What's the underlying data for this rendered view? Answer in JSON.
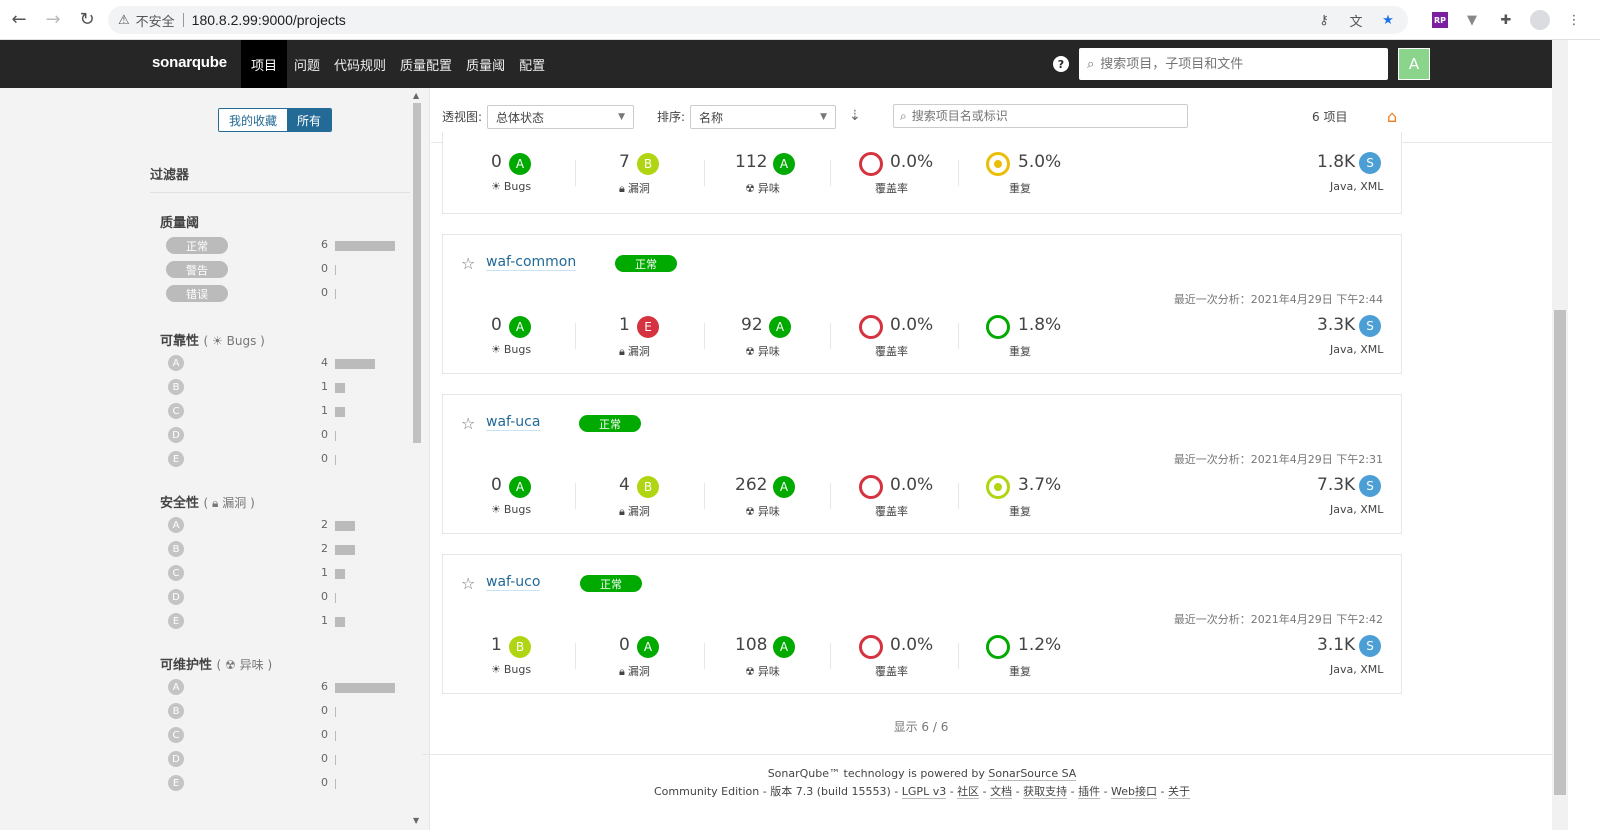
{
  "browser": {
    "back_icon": "arrow-left-icon",
    "forward_icon": "arrow-right-icon",
    "reload_icon": "reload-icon",
    "insecure_label": "不安全",
    "url": "180.8.2.99:9000/projects",
    "ext_rp": "RP"
  },
  "nav": {
    "logo_text": "sonarqube",
    "items": [
      "项目",
      "问题",
      "代码规则",
      "质量配置",
      "质量阈",
      "配置"
    ],
    "search_placeholder": "搜索项目，子项目和文件",
    "user_initial": "A"
  },
  "sidebar": {
    "fav_label": "我的收藏",
    "all_label": "所有",
    "filters_title": "过滤器",
    "quality_gate": {
      "title": "质量阈",
      "rows": [
        {
          "label": "正常",
          "count": "6"
        },
        {
          "label": "警告",
          "count": "0"
        },
        {
          "label": "错误",
          "count": "0"
        }
      ]
    },
    "reliability": {
      "title": "可靠性",
      "sub": "Bugs",
      "rows": [
        {
          "label": "A",
          "count": "4"
        },
        {
          "label": "B",
          "count": "1"
        },
        {
          "label": "C",
          "count": "1"
        },
        {
          "label": "D",
          "count": "0"
        },
        {
          "label": "E",
          "count": "0"
        }
      ]
    },
    "security": {
      "title": "安全性",
      "sub": "漏洞",
      "rows": [
        {
          "label": "A",
          "count": "2"
        },
        {
          "label": "B",
          "count": "2"
        },
        {
          "label": "C",
          "count": "1"
        },
        {
          "label": "D",
          "count": "0"
        },
        {
          "label": "E",
          "count": "1"
        }
      ]
    },
    "maintainability": {
      "title": "可维护性",
      "sub": "异味",
      "rows": [
        {
          "label": "A",
          "count": "6"
        },
        {
          "label": "B",
          "count": "0"
        },
        {
          "label": "C",
          "count": "0"
        },
        {
          "label": "D",
          "count": "0"
        },
        {
          "label": "E",
          "count": "0"
        }
      ]
    }
  },
  "toolbar": {
    "perspective_label": "透视图:",
    "perspective_value": "总体状态",
    "sort_label": "排序:",
    "sort_value": "名称",
    "search_placeholder": "搜索项目名或标识",
    "project_count": "6 项目"
  },
  "labels": {
    "bugs": "Bugs",
    "vulns": "漏洞",
    "smells": "异味",
    "coverage": "覆盖率",
    "dup": "重复",
    "lang_icon": "S"
  },
  "projects": [
    {
      "bugs": "0",
      "bugs_rating": "A",
      "vulns": "7",
      "vulns_rating": "B",
      "smells": "112",
      "smells_rating": "A",
      "coverage": "0.0%",
      "duplications": "5.0%",
      "ncloc": "1.8K",
      "languages": "Java, XML"
    },
    {
      "name": "waf-common",
      "status": "正常",
      "last_analysis": "最近一次分析：2021年4月29日 下午2:44",
      "bugs": "0",
      "bugs_rating": "A",
      "vulns": "1",
      "vulns_rating": "E",
      "smells": "92",
      "smells_rating": "A",
      "coverage": "0.0%",
      "duplications": "1.8%",
      "ncloc": "3.3K",
      "languages": "Java, XML"
    },
    {
      "name": "waf-uca",
      "status": "正常",
      "last_analysis": "最近一次分析：2021年4月29日 下午2:31",
      "bugs": "0",
      "bugs_rating": "A",
      "vulns": "4",
      "vulns_rating": "B",
      "smells": "262",
      "smells_rating": "A",
      "coverage": "0.0%",
      "duplications": "3.7%",
      "ncloc": "7.3K",
      "languages": "Java, XML"
    },
    {
      "name": "waf-uco",
      "status": "正常",
      "last_analysis": "最近一次分析：2021年4月29日 下午2:42",
      "bugs": "1",
      "bugs_rating": "B",
      "vulns": "0",
      "vulns_rating": "A",
      "smells": "108",
      "smells_rating": "A",
      "coverage": "0.0%",
      "duplications": "1.2%",
      "ncloc": "3.1K",
      "languages": "Java, XML"
    }
  ],
  "shown": "显示 6 / 6",
  "footer": {
    "line1_prefix": "SonarQube™ technology is powered by ",
    "line1_link": "SonarSource SA",
    "edition": "Community Edition",
    "version": "版本 7.3 (build 15553)",
    "links": [
      "LGPL v3",
      "社区",
      "文档",
      "获取支持",
      "插件",
      "Web接口",
      "关于"
    ]
  },
  "colors": {
    "rating_A": "#00aa00",
    "rating_B": "#b0d513",
    "rating_E": "#d4333f",
    "coverage_ring": "#d4333f",
    "dup_ring_high": "#eabe06",
    "dup_ring_mid": "#b0d513",
    "dup_ring_low": "#00aa00",
    "lang_badge": "#4b9fd5"
  }
}
